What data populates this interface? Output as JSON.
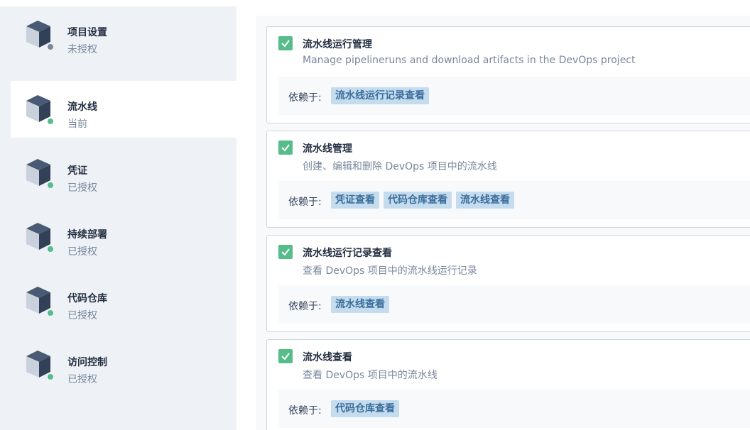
{
  "sidebar": {
    "items": [
      {
        "title": "项目设置",
        "status": "未授权",
        "status_color": "#79879c",
        "active": false
      },
      {
        "title": "流水线",
        "status": "当前",
        "status_color": "#55bc8a",
        "active": true
      },
      {
        "title": "凭证",
        "status": "已授权",
        "status_color": "#55bc8a",
        "active": false
      },
      {
        "title": "持续部署",
        "status": "已授权",
        "status_color": "#55bc8a",
        "active": false
      },
      {
        "title": "代码仓库",
        "status": "已授权",
        "status_color": "#55bc8a",
        "active": false
      },
      {
        "title": "访问控制",
        "status": "已授权",
        "status_color": "#55bc8a",
        "active": false
      }
    ]
  },
  "permissions": {
    "depends_label": "依赖于:",
    "items": [
      {
        "title": "流水线运行管理",
        "desc": "Manage pipelineruns and download artifacts in the DevOps project",
        "checked": true,
        "deps": [
          "流水线运行记录查看"
        ]
      },
      {
        "title": "流水线管理",
        "desc": "创建、编辑和删除 DevOps 项目中的流水线",
        "checked": true,
        "deps": [
          "凭证查看",
          "代码仓库查看",
          "流水线查看"
        ]
      },
      {
        "title": "流水线运行记录查看",
        "desc": "查看 DevOps 项目中的流水线运行记录",
        "checked": true,
        "deps": [
          "流水线查看"
        ]
      },
      {
        "title": "流水线查看",
        "desc": "查看 DevOps 项目中的流水线",
        "checked": true,
        "deps": [
          "代码仓库查看"
        ]
      }
    ]
  },
  "colors": {
    "check_green": "#55bc8a",
    "tag_bg": "#c5dcef",
    "tag_text": "#3b6e9b"
  },
  "icons": {
    "nav": "cube-icon",
    "check": "checkmark-icon"
  }
}
